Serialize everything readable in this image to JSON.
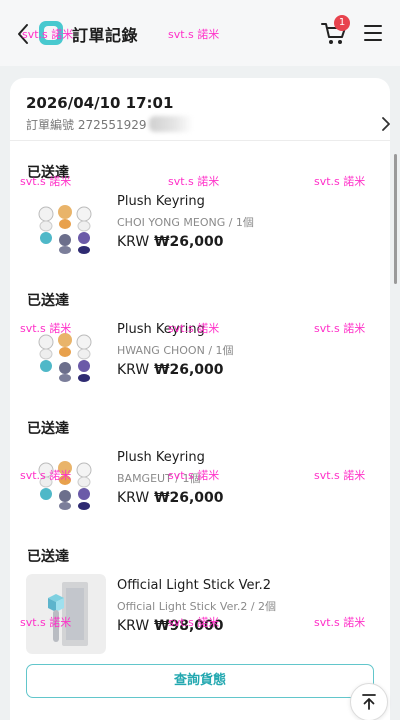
{
  "header": {
    "title": "訂單記錄",
    "cart_count": "1",
    "back_icon": "chevron-left-icon",
    "cart_icon": "cart-icon",
    "menu_icon": "hamburger-menu-icon",
    "accent_color": "#48c9cf"
  },
  "order": {
    "date": "2026/04/10 17:01",
    "number_label": "訂單編號 272551929",
    "items": [
      {
        "status": "已送達",
        "name": "Plush Keyring",
        "option": "CHOI YONG MEONG / 1個",
        "currency": "KRW",
        "price": "₩26,000"
      },
      {
        "status": "已送達",
        "name": "Plush Keyring",
        "option": "HWANG CHOON / 1個",
        "currency": "KRW",
        "price": "₩26,000"
      },
      {
        "status": "已送達",
        "name": "Plush Keyring",
        "option": "BAMGEUT / 1個",
        "currency": "KRW",
        "price": "₩26,000"
      },
      {
        "status": "已送達",
        "name": "Official Light Stick Ver.2",
        "option": "Official Light Stick Ver.2 / 2個",
        "currency": "KRW",
        "price": "₩98,000"
      }
    ]
  },
  "track_button": "查詢貨態",
  "scroll_top_icon": "arrow-up-to-top-icon",
  "watermark": "svt.s 諾米"
}
